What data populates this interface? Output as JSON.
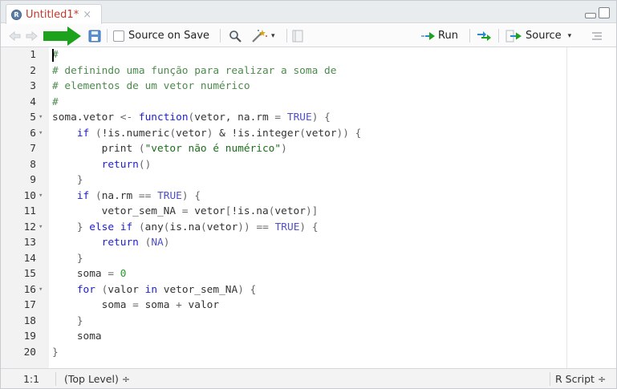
{
  "editor_tab": {
    "title": "Untitled1*",
    "close_glyph": "×"
  },
  "toolbar": {
    "source_on_save_label": "Source on Save",
    "run_label": "Run",
    "source_label": "Source",
    "icons": [
      "back-arrow-icon",
      "forward-arrow-icon",
      "save-icon",
      "search-icon",
      "magic-wand-icon",
      "compile-report-icon",
      "rerun-icon",
      "outline-icon"
    ],
    "accent_green": "#1ca21c"
  },
  "code": {
    "lines": [
      {
        "n": "1",
        "fold": false,
        "html": "<span class=\"cm\">#</span>"
      },
      {
        "n": "2",
        "fold": false,
        "html": "<span class=\"cm\"># definindo uma função para realizar a soma de</span>"
      },
      {
        "n": "3",
        "fold": false,
        "html": "<span class=\"cm\"># elementos de um vetor numérico</span>"
      },
      {
        "n": "4",
        "fold": false,
        "html": "<span class=\"cm\">#</span>"
      },
      {
        "n": "5",
        "fold": true,
        "html": "soma.vetor <span class=\"op\">&lt;-</span> <span class=\"kw\">function</span><span class=\"br\">(</span>vetor, na.rm <span class=\"op\">=</span> <span class=\"cn\">TRUE</span><span class=\"br\">)</span> <span class=\"br\">{</span>"
      },
      {
        "n": "6",
        "fold": true,
        "html": "    <span class=\"kw\">if</span> <span class=\"br\">(</span>!is.numeric<span class=\"br\">(</span>vetor<span class=\"br\">)</span> &amp; !is.integer<span class=\"br\">(</span>vetor<span class=\"br\">))</span> <span class=\"br\">{</span>"
      },
      {
        "n": "7",
        "fold": false,
        "html": "        print <span class=\"br\">(</span><span class=\"str\">\"vetor não é numérico\"</span><span class=\"br\">)</span>"
      },
      {
        "n": "8",
        "fold": false,
        "html": "        <span class=\"kw\">return</span><span class=\"br\">()</span>"
      },
      {
        "n": "9",
        "fold": false,
        "html": "    <span class=\"br\">}</span>"
      },
      {
        "n": "10",
        "fold": true,
        "html": "    <span class=\"kw\">if</span> <span class=\"br\">(</span>na.rm <span class=\"op\">==</span> <span class=\"cn\">TRUE</span><span class=\"br\">)</span> <span class=\"br\">{</span>"
      },
      {
        "n": "11",
        "fold": false,
        "html": "        vetor_sem_NA <span class=\"op\">=</span> vetor<span class=\"br\">[</span>!is.na<span class=\"br\">(</span>vetor<span class=\"br\">)]</span>"
      },
      {
        "n": "12",
        "fold": true,
        "html": "    <span class=\"br\">}</span> <span class=\"kw\">else</span> <span class=\"kw\">if</span> <span class=\"br\">(</span>any<span class=\"br\">(</span>is.na<span class=\"br\">(</span>vetor<span class=\"br\">))</span> <span class=\"op\">==</span> <span class=\"cn\">TRUE</span><span class=\"br\">)</span> <span class=\"br\">{</span>"
      },
      {
        "n": "13",
        "fold": false,
        "html": "        <span class=\"kw\">return</span> <span class=\"br\">(</span><span class=\"cn\">NA</span><span class=\"br\">)</span>"
      },
      {
        "n": "14",
        "fold": false,
        "html": "    <span class=\"br\">}</span>"
      },
      {
        "n": "15",
        "fold": false,
        "html": "    soma <span class=\"op\">=</span> <span class=\"num\">0</span>"
      },
      {
        "n": "16",
        "fold": true,
        "html": "    <span class=\"kw\">for</span> <span class=\"br\">(</span>valor <span class=\"kw\">in</span> vetor_sem_NA<span class=\"br\">)</span> <span class=\"br\">{</span>"
      },
      {
        "n": "17",
        "fold": false,
        "html": "        soma <span class=\"op\">=</span> soma <span class=\"op\">+</span> valor"
      },
      {
        "n": "18",
        "fold": false,
        "html": "    <span class=\"br\">}</span>"
      },
      {
        "n": "19",
        "fold": false,
        "html": "    soma"
      },
      {
        "n": "20",
        "fold": false,
        "html": "<span class=\"br\">}</span>"
      }
    ]
  },
  "status": {
    "position": "1:1",
    "scope": "(Top Level) ÷",
    "file_type": "R Script ÷"
  }
}
